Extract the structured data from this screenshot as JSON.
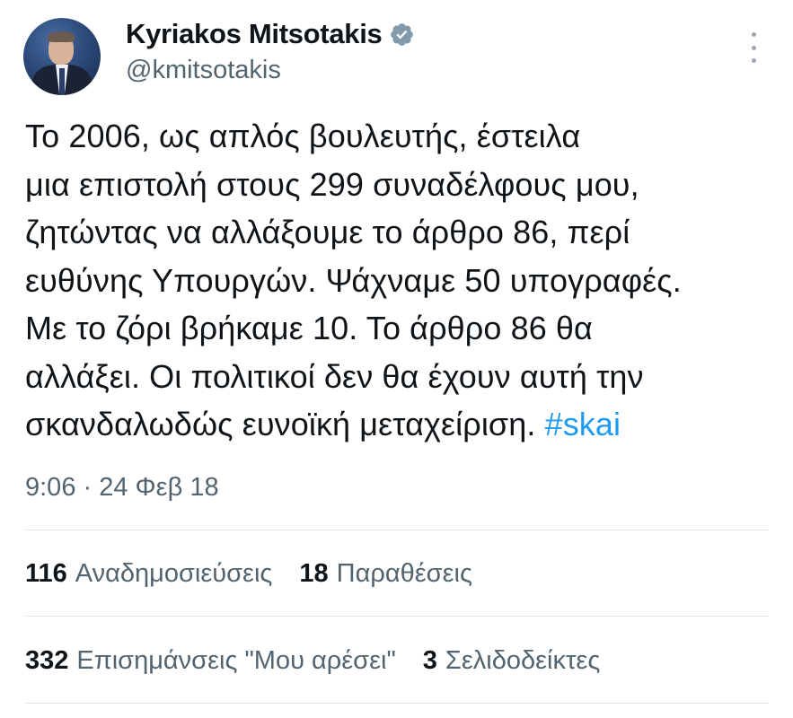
{
  "author": {
    "display_name": "Kyriakos Mitsotakis",
    "handle": "@kmitsotakis",
    "verified_icon": "verified-badge-icon",
    "verified_color": "#829aab"
  },
  "tweet": {
    "lines": [
      "Το 2006, ως απλός βουλευτής, έστειλα",
      "μια επιστολή στους 299 συναδέλφους μου,",
      "ζητώντας να αλλάξουμε το άρθρο 86, περί",
      "ευθύνης Υπουργών. Ψάχναμε 50 υπογραφές.",
      "Με το ζόρι βρήκαμε 10. Το άρθρο 86 θα",
      "αλλάξει. Οι πολιτικοί δεν θα έχουν αυτή την",
      "σκανδαλωδώς ευνοϊκή μεταχείριση."
    ],
    "hashtag": "#skai",
    "hashtag_color": "#1d9bf0",
    "timestamp": "9:06 · 24 Φεβ 18"
  },
  "stats": {
    "retweets": {
      "count": "116",
      "label": "Αναδημοσιεύσεις"
    },
    "quotes": {
      "count": "18",
      "label": "Παραθέσεις"
    },
    "likes": {
      "count": "332",
      "label": "Επισημάνσεις \"Μου αρέσει\""
    },
    "bookmarks": {
      "count": "3",
      "label": "Σελιδοδείκτες"
    }
  },
  "icons": {
    "more": "more-options-icon",
    "avatar": "avatar"
  }
}
